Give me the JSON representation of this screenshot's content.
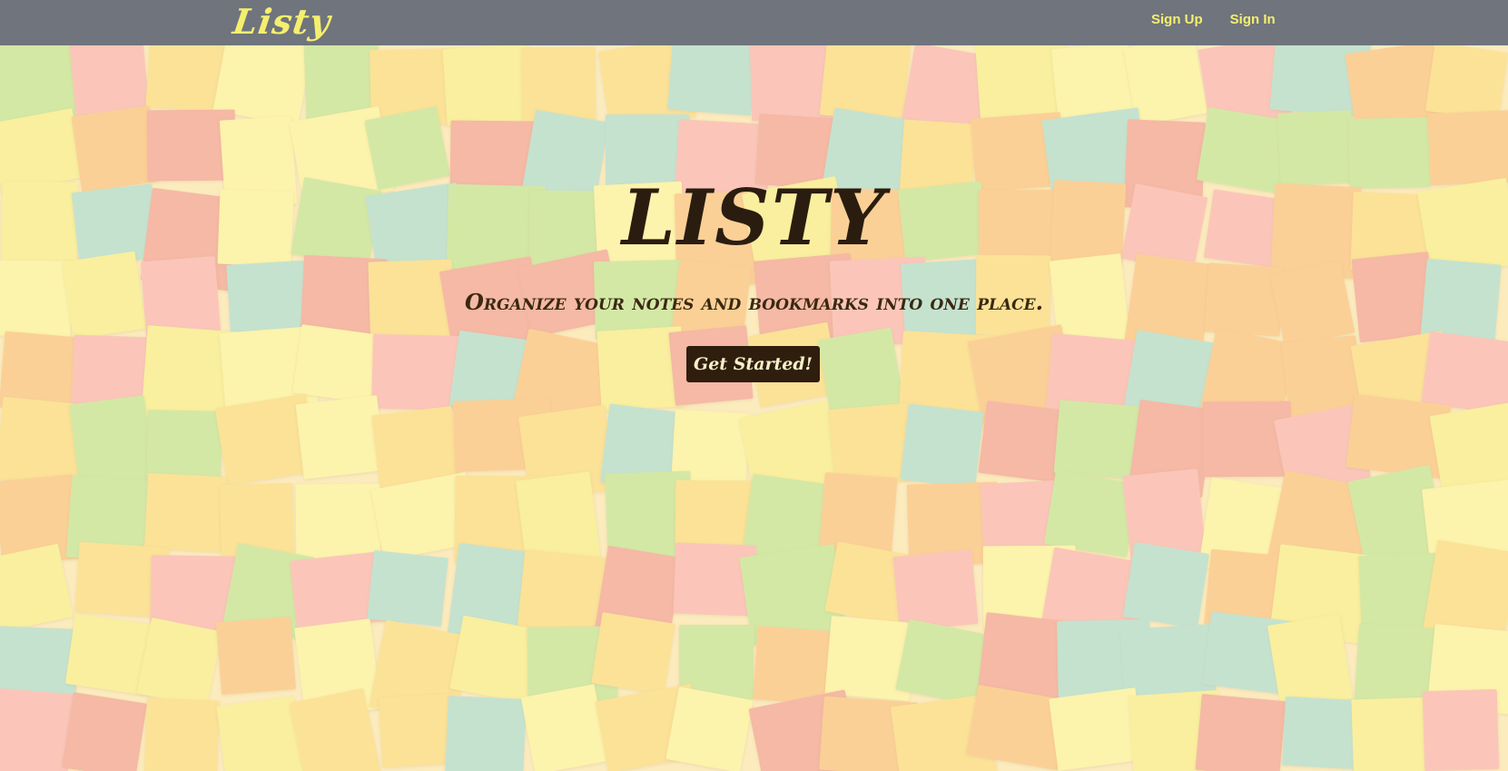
{
  "navbar": {
    "brand": "Listy",
    "links": [
      {
        "label": "Sign Up"
      },
      {
        "label": "Sign In"
      }
    ],
    "background": "#6f747d",
    "accent": "#f4ef6e"
  },
  "hero": {
    "title": "LISTY",
    "subtitle": "Organize your notes and bookmarks into one place.",
    "cta_label": "Get Started!"
  },
  "background": {
    "description_icon": "sticky-notes-wall",
    "colors": [
      "#f6a25a",
      "#f7c95c",
      "#f2e66a",
      "#e86f7a",
      "#9fd77a",
      "#7fcbd8",
      "#f58ca6",
      "#f9f08a"
    ]
  }
}
